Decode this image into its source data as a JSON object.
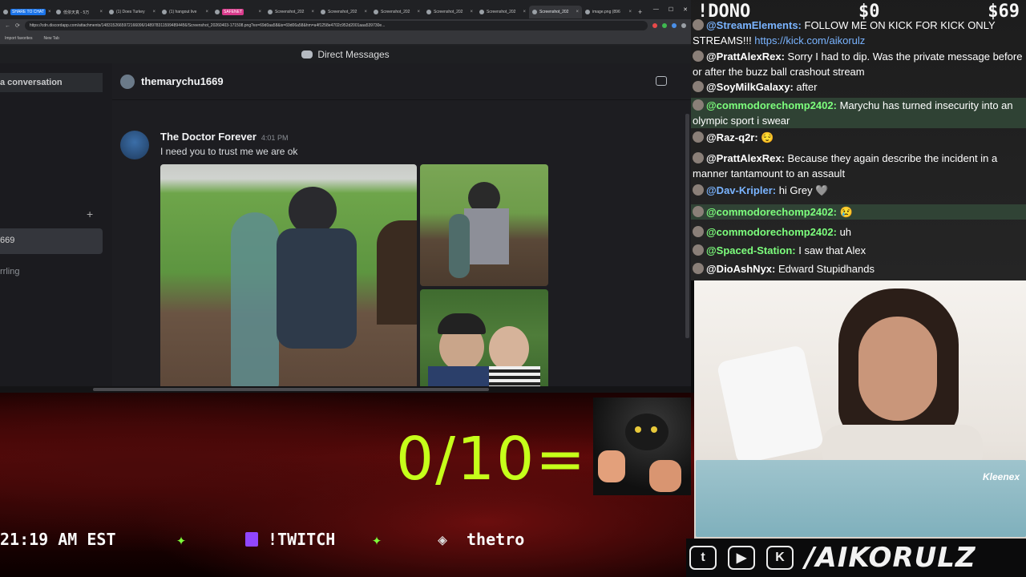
{
  "browser": {
    "tabs": [
      {
        "label": "SHARE TO CHAT",
        "style": "blue"
      },
      {
        "label": "低依天真 - 5万",
        "style": "normal"
      },
      {
        "label": "(1) Does Turkey",
        "style": "normal"
      },
      {
        "label": "(1) hangout live",
        "style": "normal"
      },
      {
        "label": "SAFENET",
        "style": "pill"
      },
      {
        "label": "Screenshot_202",
        "style": "normal"
      },
      {
        "label": "Screenshot_202",
        "style": "normal"
      },
      {
        "label": "Screenshot_202",
        "style": "normal"
      },
      {
        "label": "Screenshot_202",
        "style": "normal"
      },
      {
        "label": "Screenshot_202",
        "style": "normal"
      },
      {
        "label": "Screenshot_202",
        "style": "active"
      },
      {
        "label": "image.png (896",
        "style": "normal"
      }
    ],
    "url": "https://cdn.discordapp.com/attachments/1483152665972166096/1489783115994894456/Screenshot_20260403-171508.png?ex=69d0aa58&is=69d06a58&hm=a4f1258e4702c952d2001aaa539730e...",
    "bookmarks": [
      "Import favorites",
      "New Tab"
    ]
  },
  "discord": {
    "header_title": "Direct Messages",
    "start_conversation": "a conversation",
    "dm_items": [
      "669",
      "rrling"
    ],
    "channel_name": "themarychu1669",
    "message": {
      "author": "The Doctor Forever",
      "time": "4:01 PM",
      "text": "I need you to trust me we are ok"
    }
  },
  "overlay": {
    "dono_label": "!DONO",
    "dono_amount1": "$0",
    "dono_amount2": "$69",
    "chat": [
      {
        "user": "@StreamElements:",
        "text": " FOLLOW ME ON KICK FOR KICK ONLY STREAMS!!! ",
        "link": "https://kick.com/aikorulz",
        "user_color": "#7ab4ff",
        "highlight": false
      },
      {
        "user": "@PrattAlexRex:",
        "text": " Sorry I had to dip. Was the private message before or after the buzz ball crashout stream",
        "link": "",
        "user_color": "#ffffff",
        "highlight": false
      },
      {
        "user": "@SoyMilkGalaxy:",
        "text": " after",
        "link": "",
        "user_color": "#ffffff",
        "highlight": false
      },
      {
        "user": "@commodorechomp2402:",
        "text": " Marychu has turned insecurity into an olympic sport i swear",
        "link": "",
        "user_color": "#7dff7d",
        "highlight": true
      },
      {
        "user": "@Raz-q2r:",
        "text": " 😌",
        "link": "",
        "user_color": "#ffffff",
        "highlight": false
      },
      {
        "user": "@PrattAlexRex:",
        "text": " Because they again describe the incident in a manner tantamount to an assault",
        "link": "",
        "user_color": "#ffffff",
        "highlight": false
      },
      {
        "user": "@Dav-Kripler:",
        "text": " hi Grey 🩶",
        "link": "",
        "user_color": "#7ab4ff",
        "highlight": false
      },
      {
        "user": "@commodorechomp2402:",
        "text": " 😢",
        "link": "",
        "user_color": "#7dff7d",
        "highlight": true
      },
      {
        "user": "@commodorechomp2402:",
        "text": " uh",
        "link": "",
        "user_color": "#7dff7d",
        "highlight": false
      },
      {
        "user": "@Spaced-Station:",
        "text": " I saw that Alex",
        "link": "",
        "user_color": "#7dff7d",
        "highlight": false
      },
      {
        "user": "@DioAshNyx:",
        "text": " Edward Stupidhands",
        "link": "",
        "user_color": "#ffffff",
        "highlight": false
      }
    ],
    "score": "0/10=",
    "ticker": {
      "time": "21:19 AM EST",
      "twitch": "!TWITCH",
      "partial": "thetro"
    },
    "kleenex_brand": "Kleenex",
    "handle": "/AIKORULZ"
  },
  "colors": {
    "score": "#c6ff1a",
    "ticker_star": "#7dff3a",
    "discord_bg": "#1d1d21"
  }
}
